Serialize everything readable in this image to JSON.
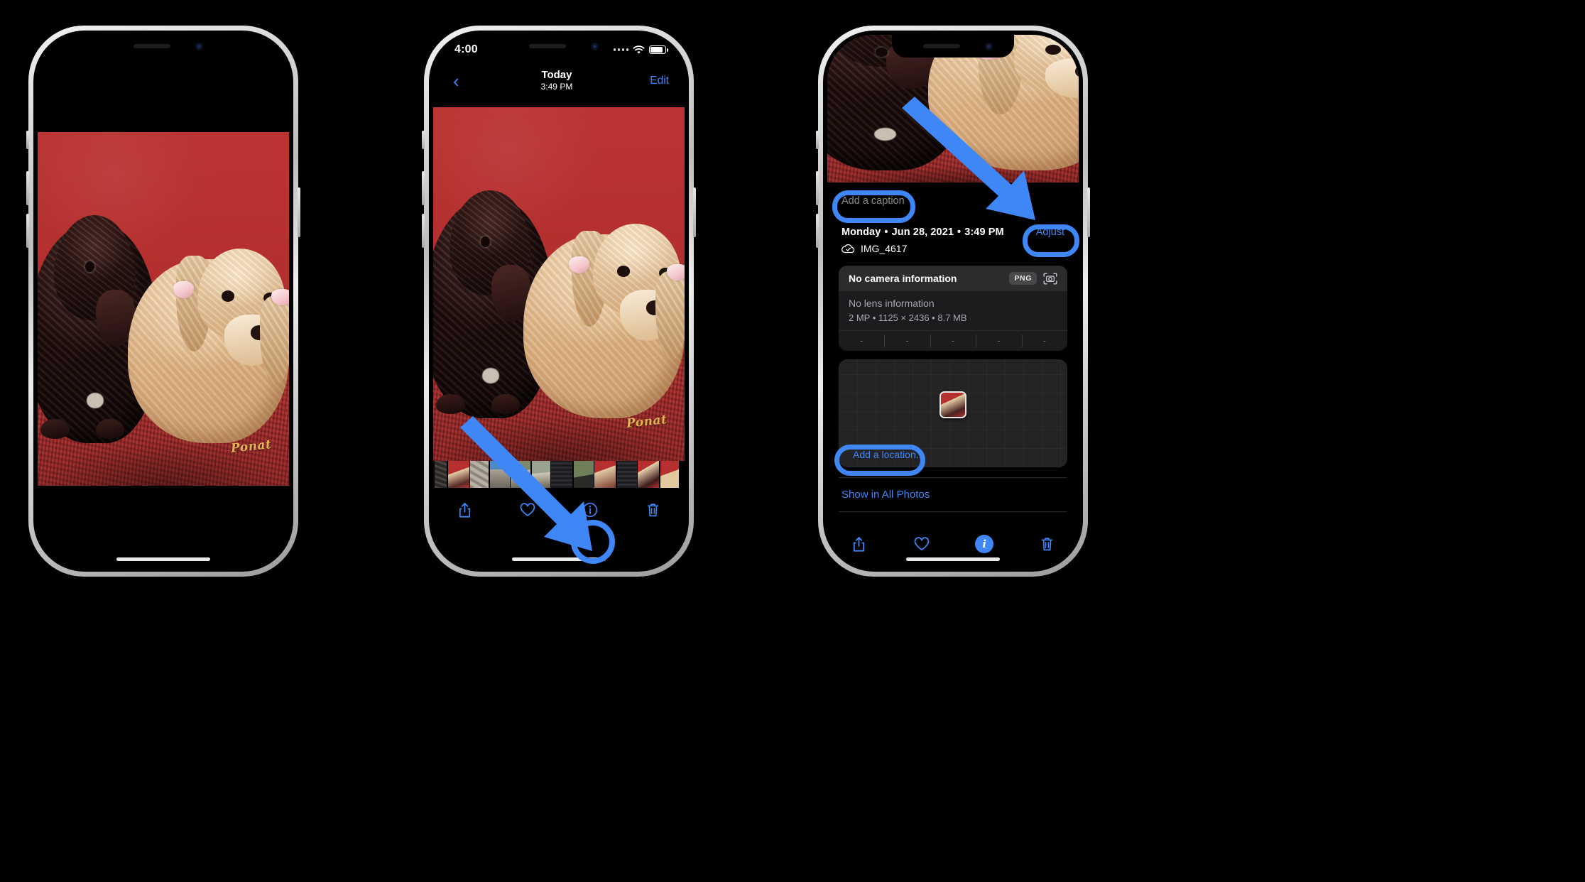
{
  "accent_blue": "#3f86f6",
  "annotation_blue": "#3f86f6",
  "photo_red": "#b5302f",
  "photo": {
    "signature": "Ponat",
    "alt": "two-cocker-spaniels-on-red-velvet"
  },
  "phone1": {
    "name": "photo-fullscreen-view"
  },
  "phone2": {
    "statusbar": {
      "time": "4:00",
      "wifi": "wifi-icon",
      "battery": "battery-icon",
      "signal": "signal-dots-icon"
    },
    "navbar": {
      "back": "‹",
      "title": "Today",
      "subtitle": "3:49 PM",
      "edit": "Edit"
    },
    "toolbar": {
      "share": "share-icon",
      "favorite": "heart-icon",
      "info": "info-icon",
      "delete": "trash-icon"
    }
  },
  "phone3": {
    "caption": {
      "placeholder": "Add a caption"
    },
    "meta": {
      "weekday": "Monday",
      "sep1": "•",
      "date": "Jun 28, 2021",
      "sep2": "•",
      "time": "3:49 PM",
      "adjust": "Adjust",
      "filename": "IMG_4617",
      "cloud": "icloud-check-icon"
    },
    "camera_card": {
      "title": "No camera information",
      "format_badge": "PNG",
      "camera_icon": "camera-viewfinder-icon",
      "lens": "No lens information",
      "specs": "2 MP  •  1125 × 2436  •  8.7 MB",
      "exif": [
        "-",
        "-",
        "-",
        "-",
        "-"
      ]
    },
    "map": {
      "pin": "photo-map-pin",
      "add_location": "Add a location..."
    },
    "show_in_all_photos": "Show in All Photos",
    "toolbar": {
      "share": "share-icon",
      "favorite": "heart-icon",
      "info": "info-icon-active",
      "delete": "trash-icon"
    }
  },
  "annotations": {
    "phone2_info_circle": "highlight-info-button",
    "phone2_arrow": "arrow-pointing-to-info-button",
    "phone3_caption_ring": "highlight-add-caption",
    "phone3_adjust_ring": "highlight-adjust-button",
    "phone3_location_ring": "highlight-add-location",
    "phone3_arrow": "arrow-pointing-to-adjust-button"
  }
}
